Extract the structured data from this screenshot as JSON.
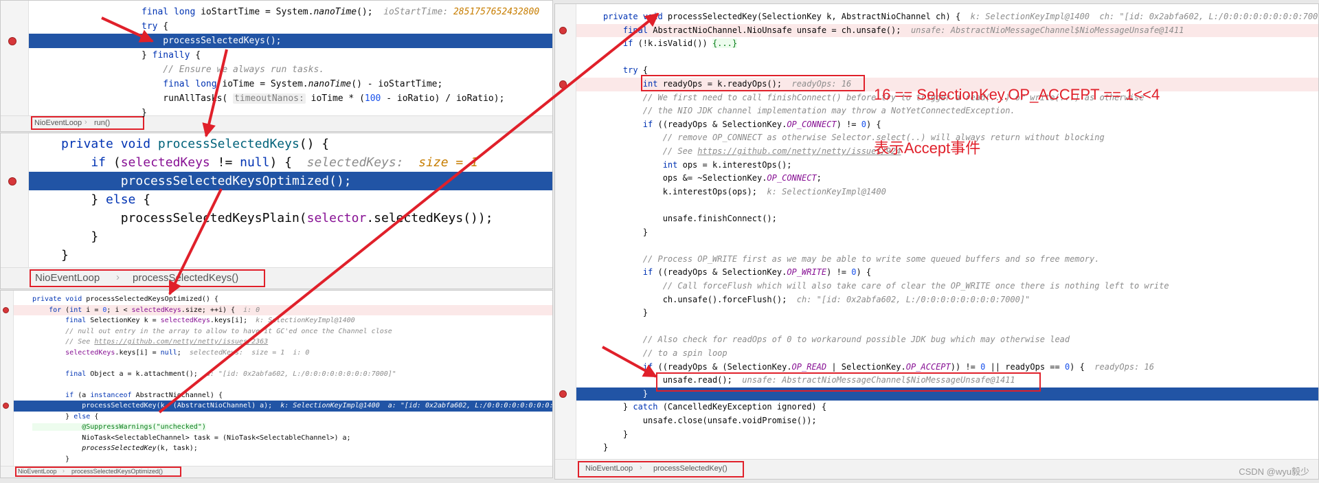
{
  "panel_run": {
    "lines": [
      {
        "parts": [
          {
            "t": "final long ",
            "c": "k"
          },
          {
            "t": "ioStartTime = System."
          },
          {
            "t": "nanoTime",
            "c": "it"
          },
          {
            "t": "();  "
          },
          {
            "t": "ioStartTime: ",
            "c": "inl"
          },
          {
            "t": "2851757652432800",
            "c": "inlorange"
          }
        ]
      },
      {
        "parts": [
          {
            "t": "try",
            "c": "k"
          },
          {
            "t": " {"
          }
        ]
      },
      {
        "parts": [
          {
            "t": "    processSelectedKeys();"
          }
        ]
      },
      {
        "parts": [
          {
            "t": "} "
          },
          {
            "t": "finally",
            "c": "k"
          },
          {
            "t": " {"
          }
        ]
      },
      {
        "parts": [
          {
            "t": "    // Ensure we always run tasks.",
            "c": "cm"
          }
        ]
      },
      {
        "parts": [
          {
            "t": "    final long ",
            "c": "k"
          },
          {
            "t": "ioTime = System."
          },
          {
            "t": "nanoTime",
            "c": "it"
          },
          {
            "t": "() - ioStartTime;"
          }
        ]
      },
      {
        "parts": [
          {
            "t": "    runAllTasks( "
          },
          {
            "t": "timeoutNanos:",
            "c": "hint"
          },
          {
            "t": " ioTime * ("
          },
          {
            "t": "100",
            "c": "num"
          },
          {
            "t": " - ioRatio) / ioRatio);"
          }
        ]
      },
      {
        "parts": [
          {
            "t": "}"
          }
        ]
      }
    ],
    "breadcrumb": [
      "NioEventLoop",
      "run()"
    ]
  },
  "panel_pk": {
    "lines": [
      {
        "parts": [
          {
            "t": "private void ",
            "c": "k"
          },
          {
            "t": "processSelectedKeys",
            "c": "fn"
          },
          {
            "t": "() {"
          }
        ]
      },
      {
        "parts": [
          {
            "t": "    if",
            "c": "k"
          },
          {
            "t": " ("
          },
          {
            "t": "selectedKeys",
            "c": "field"
          },
          {
            "t": " != "
          },
          {
            "t": "null",
            "c": "k"
          },
          {
            "t": ") {  "
          },
          {
            "t": "selectedKeys:  ",
            "c": "inl"
          },
          {
            "t": "size = 1",
            "c": "inlorange"
          }
        ]
      },
      {
        "parts": [
          {
            "t": "        processSelectedKeysOptimized();"
          }
        ]
      },
      {
        "parts": [
          {
            "t": "    } "
          },
          {
            "t": "else",
            "c": "k"
          },
          {
            "t": " {"
          }
        ]
      },
      {
        "parts": [
          {
            "t": "        processSelectedKeysPlain("
          },
          {
            "t": "selector",
            "c": "field"
          },
          {
            "t": ".selectedKeys());"
          }
        ]
      },
      {
        "parts": [
          {
            "t": "    }"
          }
        ]
      },
      {
        "parts": [
          {
            "t": "}"
          }
        ]
      }
    ],
    "breadcrumb": [
      "NioEventLoop",
      "processSelectedKeys()"
    ]
  },
  "panel_opt": {
    "lines": [
      {
        "parts": [
          {
            "t": "private void ",
            "c": "k"
          },
          {
            "t": "processSelectedKeysOptimized() {"
          }
        ]
      },
      {
        "parts": [
          {
            "t": "    for",
            "c": "k"
          },
          {
            "t": " ("
          },
          {
            "t": "int ",
            "c": "k"
          },
          {
            "t": "i = "
          },
          {
            "t": "0",
            "c": "num"
          },
          {
            "t": "; i < "
          },
          {
            "t": "selectedKeys",
            "c": "field"
          },
          {
            "t": ".size; ++i) {  "
          },
          {
            "t": "i: 0",
            "c": "inl"
          }
        ]
      },
      {
        "parts": [
          {
            "t": "        final ",
            "c": "k"
          },
          {
            "t": "SelectionKey k = "
          },
          {
            "t": "selectedKeys",
            "c": "field"
          },
          {
            "t": ".keys[i];  "
          },
          {
            "t": "k: SelectionKeyImpl@1400",
            "c": "inl"
          }
        ]
      },
      {
        "parts": [
          {
            "t": "        // null out entry in the array to allow to have it GC'ed once the Channel close",
            "c": "cm"
          }
        ]
      },
      {
        "parts": [
          {
            "t": "        // See ",
            "c": "cm"
          },
          {
            "t": "https://github.com/netty/netty/issues/2363",
            "c": "link"
          }
        ]
      },
      {
        "parts": [
          {
            "t": "        selectedKeys",
            "c": "field"
          },
          {
            "t": ".keys[i] = "
          },
          {
            "t": "null",
            "c": "k"
          },
          {
            "t": ";  "
          },
          {
            "t": "selectedKeys:  size = 1  i: 0",
            "c": "inl"
          }
        ]
      },
      {
        "parts": [
          {
            "t": ""
          }
        ]
      },
      {
        "parts": [
          {
            "t": "        final ",
            "c": "k"
          },
          {
            "t": "Object a = k.attachment();  "
          },
          {
            "t": "a: \"[id: 0x2abfa602, L:/0:0:0:0:0:0:0:0:7000]\"",
            "c": "inl"
          }
        ]
      },
      {
        "parts": [
          {
            "t": ""
          }
        ]
      },
      {
        "parts": [
          {
            "t": "        if",
            "c": "k"
          },
          {
            "t": " (a "
          },
          {
            "t": "instanceof",
            "c": "k"
          },
          {
            "t": " AbstractNioChannel) {"
          }
        ]
      },
      {
        "parts": [
          {
            "t": "            processSelectedKey(k, (AbstractNioChannel) a);  "
          },
          {
            "t": "k: SelectionKeyImpl@1400  a: \"[id: 0x2abfa602, L:/0:0:0:0:0:0:0:0:7000]",
            "c": "inl"
          }
        ]
      },
      {
        "parts": [
          {
            "t": "        } "
          },
          {
            "t": "else",
            "c": "k"
          },
          {
            "t": " {"
          }
        ]
      },
      {
        "parts": [
          {
            "t": "            @SuppressWarnings(\"unchecked\")",
            "c": "fold"
          }
        ]
      },
      {
        "parts": [
          {
            "t": "            NioTask<SelectableChannel> task = (NioTask<SelectableChannel>) a;"
          }
        ]
      },
      {
        "parts": [
          {
            "t": "            processSelectedKey",
            "c": "it"
          },
          {
            "t": "(k, task);"
          }
        ]
      },
      {
        "parts": [
          {
            "t": "        }"
          }
        ]
      }
    ],
    "breadcrumb": [
      "NioEventLoop",
      "processSelectedKeysOptimized()"
    ]
  },
  "panel_key": {
    "lines": [
      {
        "parts": [
          {
            "t": "private void ",
            "c": "k"
          },
          {
            "t": "processSelectedKey(SelectionKey k, AbstractNioChannel ch) {  "
          },
          {
            "t": "k: SelectionKeyImpl@1400  ch: \"[id: 0x2abfa602, L:/0:0:0:0:0:0:0:0:7000]\"",
            "c": "inl"
          }
        ]
      },
      {
        "parts": [
          {
            "t": "    final ",
            "c": "k"
          },
          {
            "t": "AbstractNioChannel.NioUnsafe unsafe = ch.unsafe();  "
          },
          {
            "t": "unsafe: AbstractNioMessageChannel$NioMessageUnsafe@1411",
            "c": "inl"
          }
        ]
      },
      {
        "parts": [
          {
            "t": "    if",
            "c": "k"
          },
          {
            "t": " (!k.isValid()) "
          },
          {
            "t": "{...}",
            "c": "fold"
          }
        ]
      },
      {
        "parts": [
          {
            "t": ""
          }
        ]
      },
      {
        "parts": [
          {
            "t": "    try",
            "c": "k"
          },
          {
            "t": " {"
          }
        ]
      },
      {
        "parts": [
          {
            "t": "        int ",
            "c": "k"
          },
          {
            "t": "readyOps = k.readyOps();  "
          },
          {
            "t": "readyOps: 16",
            "c": "inl"
          }
        ]
      },
      {
        "parts": [
          {
            "t": "        // We first need to call finishConnect() before try to trigger a read(...) or write(...) as otherwise",
            "c": "cm"
          }
        ]
      },
      {
        "parts": [
          {
            "t": "        // the NIO JDK channel implementation may throw a NotYetConnectedException.",
            "c": "cm"
          }
        ]
      },
      {
        "parts": [
          {
            "t": "        if",
            "c": "k"
          },
          {
            "t": " ((readyOps & SelectionKey."
          },
          {
            "t": "OP_CONNECT",
            "c": "cn"
          },
          {
            "t": ") != "
          },
          {
            "t": "0",
            "c": "num"
          },
          {
            "t": ") {"
          }
        ]
      },
      {
        "parts": [
          {
            "t": "            // remove OP_CONNECT as otherwise Selector.select(..) will always return without blocking",
            "c": "cm"
          }
        ]
      },
      {
        "parts": [
          {
            "t": "            // See ",
            "c": "cm"
          },
          {
            "t": "https://github.com/netty/netty/issues/924",
            "c": "link"
          }
        ]
      },
      {
        "parts": [
          {
            "t": "            int ",
            "c": "k"
          },
          {
            "t": "ops = k.interestOps();"
          }
        ]
      },
      {
        "parts": [
          {
            "t": "            ops &= ~SelectionKey."
          },
          {
            "t": "OP_CONNECT",
            "c": "cn"
          },
          {
            "t": ";"
          }
        ]
      },
      {
        "parts": [
          {
            "t": "            k.interestOps(ops);  "
          },
          {
            "t": "k: SelectionKeyImpl@1400",
            "c": "inl"
          }
        ]
      },
      {
        "parts": [
          {
            "t": ""
          }
        ]
      },
      {
        "parts": [
          {
            "t": "            unsafe.finishConnect();"
          }
        ]
      },
      {
        "parts": [
          {
            "t": "        }"
          }
        ]
      },
      {
        "parts": [
          {
            "t": ""
          }
        ]
      },
      {
        "parts": [
          {
            "t": "        // Process OP_WRITE first as we may be able to write some queued buffers and so free memory.",
            "c": "cm"
          }
        ]
      },
      {
        "parts": [
          {
            "t": "        if",
            "c": "k"
          },
          {
            "t": " ((readyOps & SelectionKey."
          },
          {
            "t": "OP_WRITE",
            "c": "cn"
          },
          {
            "t": ") != "
          },
          {
            "t": "0",
            "c": "num"
          },
          {
            "t": ") {"
          }
        ]
      },
      {
        "parts": [
          {
            "t": "            // Call forceFlush which will also take care of clear the OP_WRITE once there is nothing left to write",
            "c": "cm"
          }
        ]
      },
      {
        "parts": [
          {
            "t": "            ch.unsafe().forceFlush();  "
          },
          {
            "t": "ch: \"[id: 0x2abfa602, L:/0:0:0:0:0:0:0:0:7000]\"",
            "c": "inl"
          }
        ]
      },
      {
        "parts": [
          {
            "t": "        }"
          }
        ]
      },
      {
        "parts": [
          {
            "t": ""
          }
        ]
      },
      {
        "parts": [
          {
            "t": "        // Also check for readOps of 0 to workaround possible JDK bug which may otherwise lead",
            "c": "cm"
          }
        ]
      },
      {
        "parts": [
          {
            "t": "        // to a spin loop",
            "c": "cm"
          }
        ]
      },
      {
        "parts": [
          {
            "t": "        if",
            "c": "k"
          },
          {
            "t": " ((readyOps & (SelectionKey."
          },
          {
            "t": "OP_READ",
            "c": "cn"
          },
          {
            "t": " | SelectionKey."
          },
          {
            "t": "OP_ACCEPT",
            "c": "cn"
          },
          {
            "t": ")) != "
          },
          {
            "t": "0",
            "c": "num"
          },
          {
            "t": " || readyOps == "
          },
          {
            "t": "0",
            "c": "num"
          },
          {
            "t": ") {  "
          },
          {
            "t": "readyOps: 16",
            "c": "inl"
          }
        ]
      },
      {
        "parts": [
          {
            "t": "            unsafe.read();  "
          },
          {
            "t": "unsafe: AbstractNioMessageChannel$NioMessageUnsafe@1411",
            "c": "inl"
          }
        ]
      },
      {
        "parts": [
          {
            "t": "        }"
          }
        ]
      },
      {
        "parts": [
          {
            "t": "    } "
          },
          {
            "t": "catch",
            "c": "k"
          },
          {
            "t": " (CancelledKeyException ignored) {"
          }
        ]
      },
      {
        "parts": [
          {
            "t": "        unsafe.close(unsafe.voidPromise());"
          }
        ]
      },
      {
        "parts": [
          {
            "t": "    }"
          }
        ]
      },
      {
        "parts": [
          {
            "t": "}"
          }
        ]
      }
    ],
    "breadcrumb": [
      "NioEventLoop",
      "processSelectedKey()"
    ]
  },
  "annotation": {
    "line1": "16 == SelectionKey.OP_ACCEPT == 1<<4",
    "line2": "表示Accept事件"
  },
  "watermark": "CSDN @wyu毅少",
  "colors": {
    "accent_red": "#e0202a",
    "exec_line": "#2154a5",
    "keyword": "#0033b3",
    "comment": "#8c8c8c"
  }
}
